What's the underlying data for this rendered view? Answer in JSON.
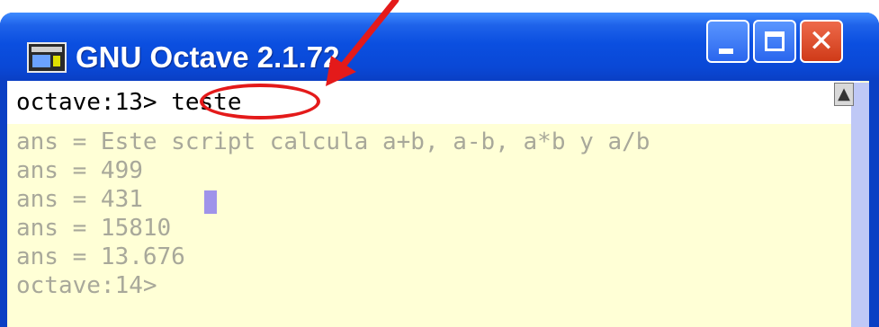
{
  "window": {
    "title": "GNU Octave 2.1.72",
    "icon": "octave-app-icon",
    "controls": {
      "minimize_icon": "minimize-icon",
      "maximize_icon": "maximize-icon",
      "close_icon": "close-icon",
      "close_glyph": "✕"
    }
  },
  "console": {
    "prompt_13": "octave:13>",
    "command": "teste",
    "output_lines": [
      "ans = Este script calcula a+b, a-b, a*b y a/b",
      "ans = 499",
      "ans = 431",
      "ans = 15810",
      "ans = 13.676"
    ],
    "prompt_14": "octave:14> ",
    "scroll_up_glyph": "▲"
  },
  "annotation": {
    "arrow_color": "#e41a1a",
    "ellipse_color": "#e41a1a"
  },
  "colors": {
    "titlebar": "#0a48d6",
    "console_bg": "#ffffd6",
    "output_text": "#a8a89a",
    "cursor": "#9f93ea"
  }
}
